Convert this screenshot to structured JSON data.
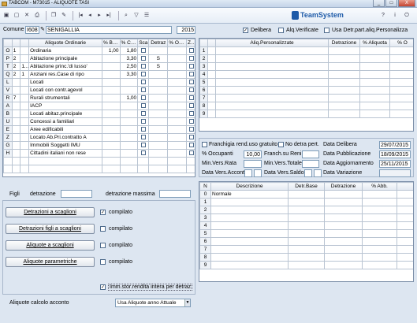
{
  "window": {
    "title": "TABCOM - M73015 - ALIQUOTE TASI",
    "minimize": "_",
    "maximize": "□",
    "close": "X"
  },
  "toolbar": {
    "brand": "TeamSystem"
  },
  "header": {
    "comune_label": "Comune",
    "comune_code": "I608",
    "comune_name": "SENIGALLIA",
    "year": "2015",
    "delibera_label": "Delibera",
    "aliq_verificate_label": "Alq.Verificate",
    "usa_detr_label": "Usa Detr.part.aliq.Personalizza"
  },
  "ordinarie": {
    "headers": [
      "",
      "",
      "Aliquote Ordinarie",
      "% Base",
      "% Com.",
      "Sca",
      "Detraz",
      "% Occu",
      "Zer"
    ],
    "rows": [
      {
        "c": "O",
        "n": "1",
        "desc": "Ordinaria",
        "base": "1,00",
        "com": "1,80",
        "detr": ""
      },
      {
        "c": "P",
        "n": "2",
        "desc": "Abitazione principale",
        "base": "",
        "com": "3,30",
        "detr": "S"
      },
      {
        "c": "T",
        "n": "2",
        "n2": "11-",
        "desc": "Abitazione princ.'di lusso'",
        "base": "",
        "com": "2,50",
        "detr": "S"
      },
      {
        "c": "Q",
        "n": "2",
        "n2": "1",
        "desc": "Anziani res.Case di ripo",
        "base": "",
        "com": "3,30",
        "detr": ""
      },
      {
        "c": "L",
        "n": "",
        "desc": "Locati",
        "base": "",
        "com": "",
        "detr": ""
      },
      {
        "c": "V",
        "n": "",
        "desc": "Locati con contr.agevol",
        "base": "",
        "com": "",
        "detr": ""
      },
      {
        "c": "R",
        "n": "7",
        "desc": "Rurali strumentali",
        "base": "",
        "com": "1,00",
        "detr": ""
      },
      {
        "c": "A",
        "n": "",
        "desc": "IACP",
        "base": "",
        "com": "",
        "detr": ""
      },
      {
        "c": "B",
        "n": "",
        "desc": "Locati abitaz.principale",
        "base": "",
        "com": "",
        "detr": ""
      },
      {
        "c": "U",
        "n": "",
        "desc": "Concessi a familiari",
        "base": "",
        "com": "",
        "detr": ""
      },
      {
        "c": "E",
        "n": "",
        "desc": "Aree edificabili",
        "base": "",
        "com": "",
        "detr": ""
      },
      {
        "c": "Z",
        "n": "",
        "desc": "Locato Ab.Pri.contratto A",
        "base": "",
        "com": "",
        "detr": ""
      },
      {
        "c": "G",
        "n": "",
        "desc": "Immobili Soggetti IMU",
        "base": "",
        "com": "",
        "detr": ""
      },
      {
        "c": "H",
        "n": "",
        "desc": "Cittadini italiani non rese",
        "base": "",
        "com": "",
        "detr": ""
      }
    ]
  },
  "personalizzate": {
    "headers": [
      "",
      "",
      "Aliq.Personalizzate",
      "Detrazione",
      "% Aliquota",
      "% O"
    ],
    "rows": [
      "1",
      "2",
      "3",
      "4",
      "5",
      "6",
      "7",
      "8",
      "9"
    ]
  },
  "figli": {
    "label": "Figli",
    "detr_label": "detrazione",
    "detr_max_label": "detrazione massima"
  },
  "buttons": [
    {
      "label": "Detrazioni a scaglioni",
      "check": "compilato",
      "checked": true
    },
    {
      "label": "Detrazioni figli a scaglioni",
      "check": "compilato",
      "checked": false
    },
    {
      "label": "Aliquote a scaglioni",
      "check": "compilato",
      "checked": false
    },
    {
      "label": "Aliquote parametriche",
      "check": "compilato",
      "checked": false
    }
  ],
  "imm_stor_label": "Imm.stor.rendita intera per detraz",
  "acconto": {
    "label": "Aliquote calcolo acconto",
    "value": "Usa Aliquote anno Attuale"
  },
  "info": {
    "franchigia_label": "Franchigia rend.uso gratuito",
    "no_detra_label": "No detra pert.",
    "occupanti_label": "% Occupanti",
    "occupanti_value": "10,00",
    "franch_reni_label": "Franch.su Reni",
    "min_vers_rata_label": "Min.Vers.Rata",
    "min_vers_tot_label": "Min.Vers.Totale",
    "data_vers_acconto_label": "Data Vers.Acconto",
    "data_vers_saldo_label": "Data Vers.Saldo",
    "data_delibera_label": "Data Delibera",
    "data_delibera": "29/07/2015",
    "data_pubblicazione_label": "Data Pubblicazione",
    "data_pubblicazione": "18/09/2015",
    "data_aggiornamento_label": "Data Aggiornamento",
    "data_aggiornamento": "25/11/2015",
    "data_variazione_label": "Data Variazione"
  },
  "detrazioni": {
    "headers": [
      "N",
      "Descrizione",
      "Detr.Base",
      "Detrazione",
      "% Abb."
    ],
    "rows": [
      {
        "n": "0",
        "desc": "Normale"
      },
      {
        "n": "1",
        "desc": ""
      },
      {
        "n": "2",
        "desc": ""
      },
      {
        "n": "3",
        "desc": ""
      },
      {
        "n": "4",
        "desc": ""
      },
      {
        "n": "5",
        "desc": ""
      },
      {
        "n": "6",
        "desc": ""
      },
      {
        "n": "7",
        "desc": ""
      },
      {
        "n": "8",
        "desc": ""
      },
      {
        "n": "9",
        "desc": ""
      }
    ]
  }
}
